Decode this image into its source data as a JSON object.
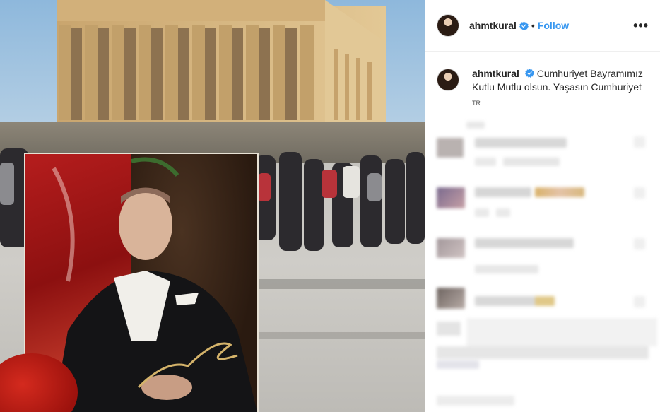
{
  "post": {
    "username": "ahmtkural",
    "follow_label": "Follow",
    "separator": "•",
    "more_label": "•••",
    "caption_text": "Cumhuriyet Bayramımız Kutlu Mutlu olsun. Yaşasın Cumhuriyet",
    "translate_label": "TR"
  },
  "colors": {
    "follow": "#3897f0",
    "verified": "#3897f0"
  }
}
